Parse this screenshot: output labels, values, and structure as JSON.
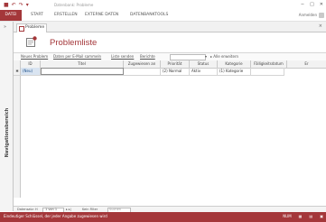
{
  "window": {
    "title": "Datenbank: Probleme",
    "controls": [
      "−",
      "□",
      "✕"
    ]
  },
  "ribbon": {
    "file_tab": "DATEI",
    "tabs": [
      "START",
      "ERSTELLEN",
      "EXTERNE DATEN",
      "DATENBANKTOOLS"
    ],
    "user": "Anmelden"
  },
  "navigation_pane": {
    "label": "Navigationsbereich",
    "collapse_glyph": "»"
  },
  "document_tab": {
    "label": "Probleme",
    "close_glyph": "×"
  },
  "form": {
    "title": "Problemliste"
  },
  "commands": {
    "new": "Neues Problem",
    "collect": "Daten per E-Mail sammeln",
    "email_list": "Liste senden",
    "reports": "Berichte",
    "expand": "▸ Alle erweitern"
  },
  "columns": [
    "ID",
    "Titel",
    "Zugewiesen an",
    "Priorität",
    "Status",
    "Kategorie",
    "Fälligkeitsdatum",
    "Er"
  ],
  "rows": [
    {
      "id": "(Neu)",
      "title": "",
      "assigned": "",
      "priority": "(2) Normal",
      "status": "Aktiv",
      "category": "(1) Kategorie",
      "due": "",
      "extra": ""
    }
  ],
  "record_nav": {
    "label": "Datensatz: H",
    "position": "1 von 1",
    "filter": "Kein Filter",
    "search": "Suchen"
  },
  "status": {
    "text": "Eindeutiger Schlüssel, der jeder Angabe zugewiesen wird",
    "mode": "NUM",
    "views": [
      "▦",
      "▤",
      "▣"
    ]
  },
  "colors": {
    "accent": "#a4373a",
    "header_bg": "#f2f2f2"
  }
}
